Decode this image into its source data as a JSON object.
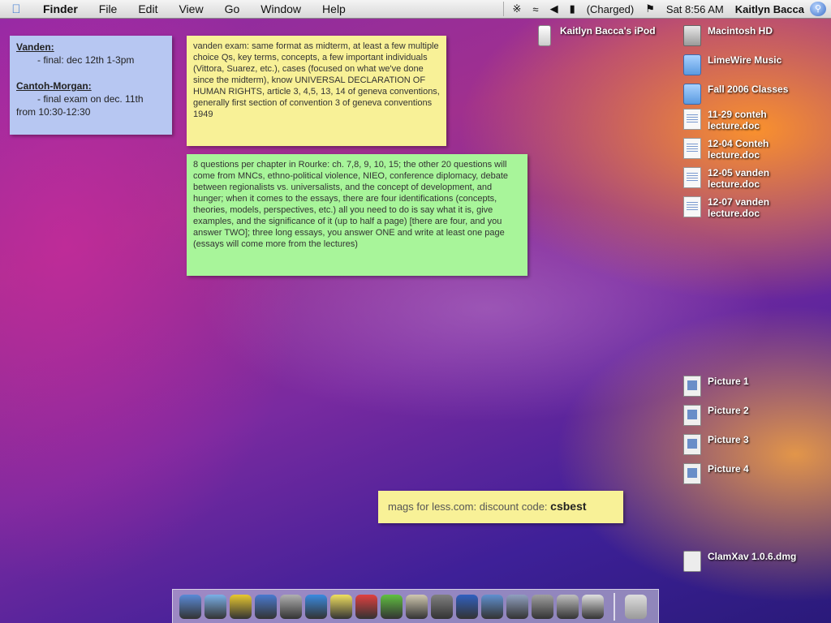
{
  "menubar": {
    "app_name": "Finder",
    "menus": [
      "File",
      "Edit",
      "View",
      "Go",
      "Window",
      "Help"
    ],
    "battery_text": "(Charged)",
    "clock": "Sat 8:56 AM",
    "user_name": "Kaitlyn Bacca"
  },
  "stickies": {
    "blue": {
      "heading1": "Vanden:",
      "line1": "- final: dec 12th 1-3pm",
      "heading2": "Cantoh-Morgan:",
      "line2": "- final exam on dec. 11th",
      "line3": "from 10:30-12:30"
    },
    "yellow1": {
      "text": "vanden exam: same format as midterm, at least a few multiple choice Qs, key terms, concepts, a few important individuals (Vittora, Suarez, etc.), cases (focused on what we've done since the midterm), know UNIVERSAL DECLARATION OF HUMAN RIGHTS, article 3, 4,5, 13, 14 of geneva conventions, generally first section of convention 3 of geneva conventions 1949"
    },
    "green": {
      "text": "8 questions per chapter in Rourke: ch. 7,8, 9, 10, 15; the other 20 questions will come from MNCs, ethno-political violence, NIEO, conference diplomacy, debate between regionalists vs. universalists, and the concept of development, and hunger; when it comes to the essays, there are four identifications (concepts, theories, models, perspectives, etc.) all you need to do is say what it is, give examples, and the significance of it (up to half a page) [there are four, and you answer TWO]; three long essays, you answer ONE and write at least one page (essays will come more from the lectures)"
    },
    "yellow2": {
      "text": "mags for less.com: discount code:",
      "code": "csbest"
    }
  },
  "desktop_icons": [
    {
      "name": "ipod",
      "label": "Kaitlyn Bacca's iPod",
      "icon": "ipod-icon"
    },
    {
      "name": "hd",
      "label": "Macintosh HD",
      "icon": "hard-drive-icon"
    },
    {
      "name": "limewire",
      "label": "LimeWire Music",
      "icon": "folder-icon"
    },
    {
      "name": "fall2006",
      "label": "Fall 2006 Classes",
      "icon": "folder-icon"
    },
    {
      "name": "doc1",
      "label": "11-29 conteh lecture.doc",
      "icon": "document-icon"
    },
    {
      "name": "doc2",
      "label": "12-04 Conteh lecture.doc",
      "icon": "document-icon"
    },
    {
      "name": "doc3",
      "label": "12-05 vanden lecture.doc",
      "icon": "document-icon"
    },
    {
      "name": "doc4",
      "label": "12-07 vanden lecture.doc",
      "icon": "document-icon"
    },
    {
      "name": "pic1",
      "label": "Picture 1",
      "icon": "picture-icon"
    },
    {
      "name": "pic2",
      "label": "Picture 2",
      "icon": "picture-icon"
    },
    {
      "name": "pic3",
      "label": "Picture 3",
      "icon": "picture-icon"
    },
    {
      "name": "pic4",
      "label": "Picture 4",
      "icon": "picture-icon"
    },
    {
      "name": "dmg",
      "label": "ClamXav 1.0.6.dmg",
      "icon": "disk-image-icon"
    }
  ],
  "dock": {
    "apps": [
      {
        "name": "finder-dock-icon",
        "color": "#5a8ad8"
      },
      {
        "name": "safari-dock-icon",
        "color": "#7ab0e8"
      },
      {
        "name": "adium-dock-icon",
        "color": "#e8c830"
      },
      {
        "name": "itunes-dock-icon",
        "color": "#4a7ad0"
      },
      {
        "name": "mail-dock-icon",
        "color": "#b0b0b0"
      },
      {
        "name": "internet-explorer-dock-icon",
        "color": "#3a8ae0"
      },
      {
        "name": "stickies-dock-icon",
        "color": "#f0e060"
      },
      {
        "name": "ical-dock-icon",
        "color": "#e04040"
      },
      {
        "name": "limewire-dock-icon",
        "color": "#60c040"
      },
      {
        "name": "address-book-dock-icon",
        "color": "#d0c8b0"
      },
      {
        "name": "photo-booth-dock-icon",
        "color": "#808080"
      },
      {
        "name": "word-dock-icon",
        "color": "#3060c0"
      },
      {
        "name": "preview-dock-icon",
        "color": "#6090d0"
      },
      {
        "name": "iphoto-dock-icon",
        "color": "#90a0c0"
      },
      {
        "name": "system-preferences-dock-icon",
        "color": "#a0a0a0"
      },
      {
        "name": "calculator-dock-icon",
        "color": "#c0c0c0"
      },
      {
        "name": "text-edit-dock-icon",
        "color": "#e0e0e0"
      }
    ],
    "trash": {
      "name": "trash-dock-icon",
      "color": "#9a9a9a"
    }
  }
}
